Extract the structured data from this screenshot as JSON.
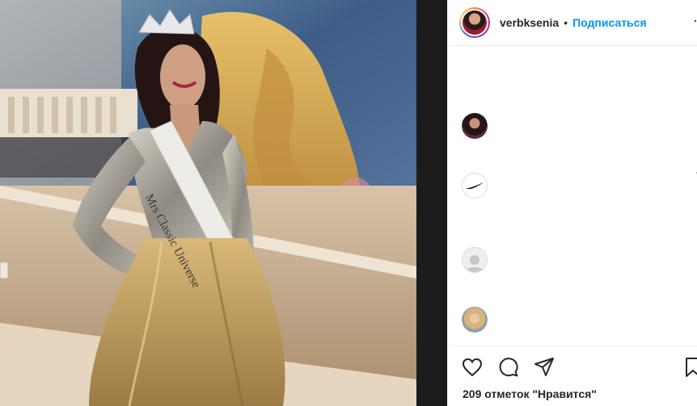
{
  "post": {
    "username": "verbksenia",
    "separator": "•",
    "follow_label": "Подписаться",
    "more_icon": "more-options-icon",
    "photo_description": "",
    "likes_text": "209 отметок \"Нравится\""
  },
  "photo": {
    "sash_text": "Mrs Classic Universe"
  },
  "comments": {
    "avatars": [
      "commenter-avatar-woman",
      "nike-logo-avatar",
      "default-user-avatar",
      "commenter-avatar-blonde"
    ]
  },
  "icons": {
    "like": "heart-icon",
    "comment": "comment-bubble-icon",
    "share": "paper-plane-icon",
    "save": "bookmark-icon"
  },
  "colors": {
    "follow": "#0095f6",
    "text": "#262626",
    "border": "#efefef"
  }
}
